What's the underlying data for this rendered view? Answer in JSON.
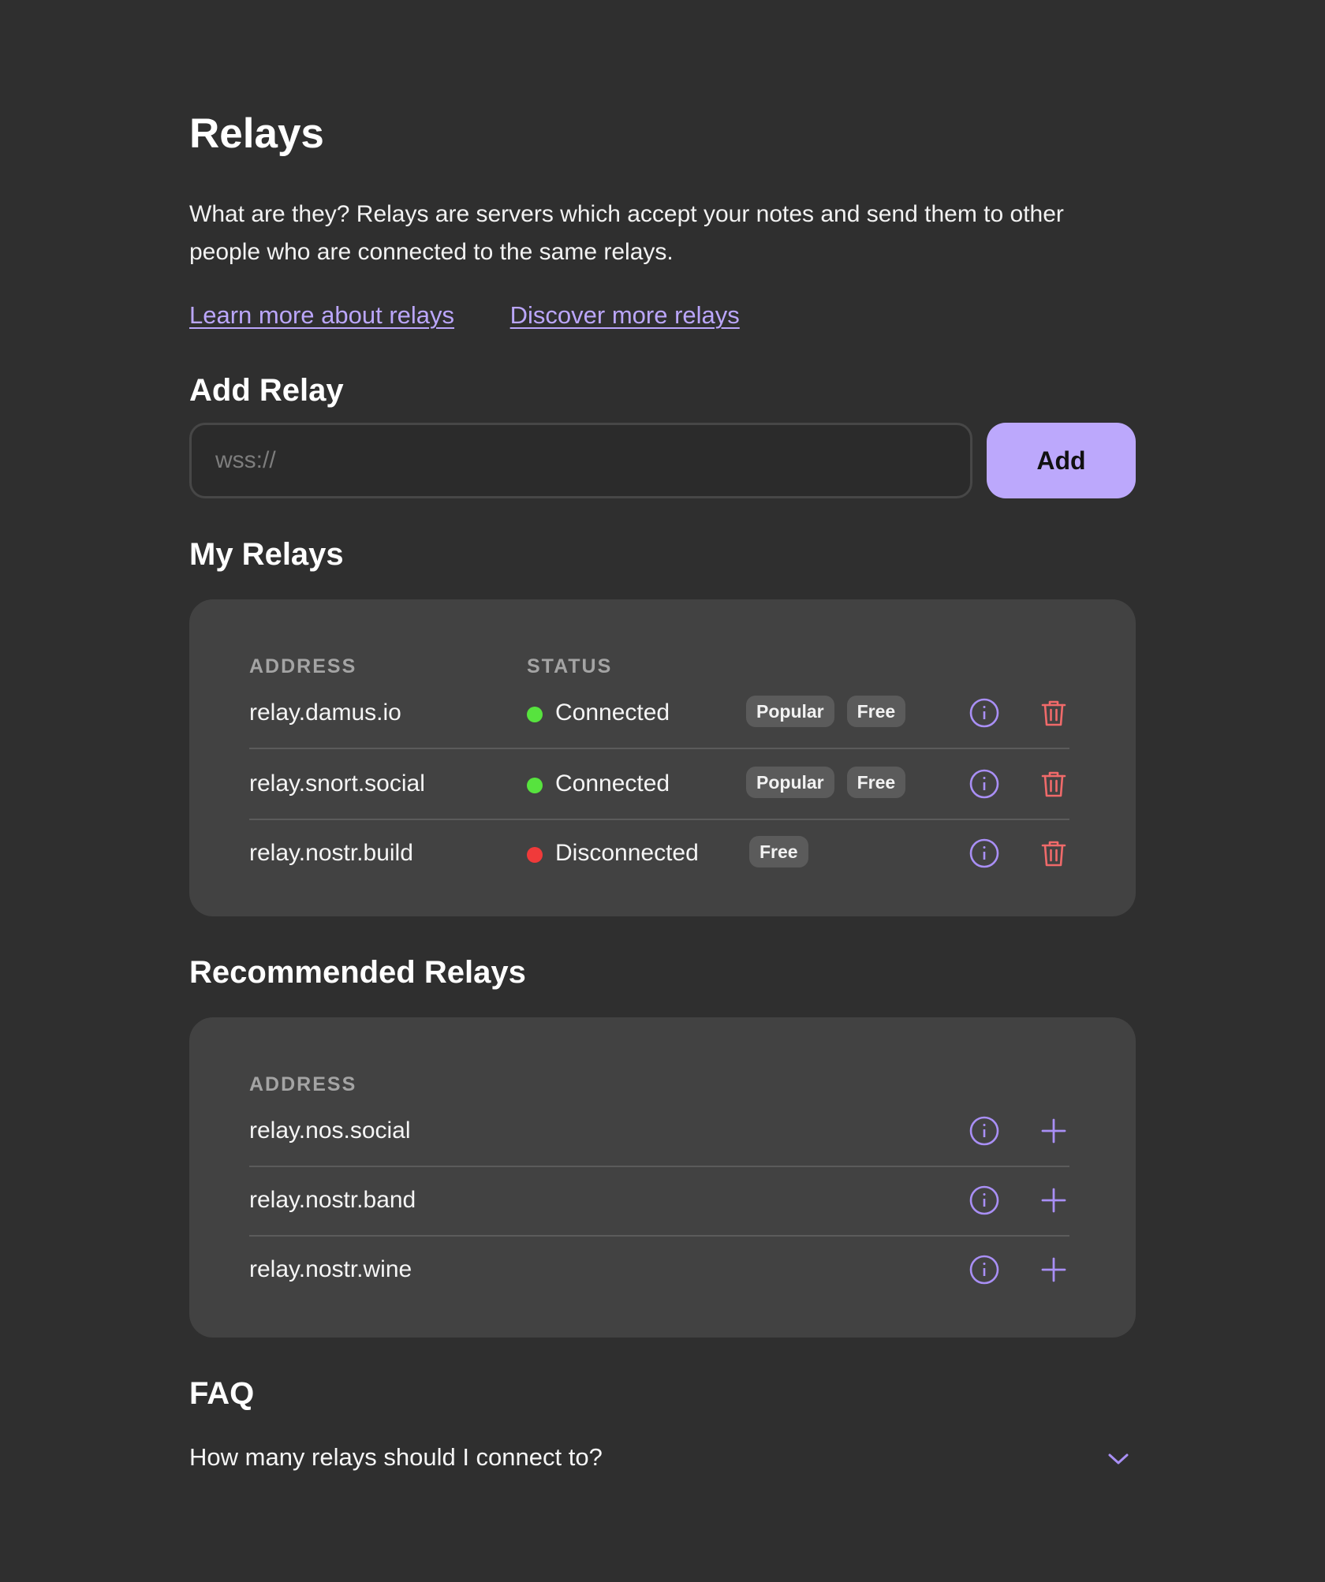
{
  "page": {
    "title": "Relays",
    "intro": "What are they? Relays are servers which accept your notes and send them to other people who are connected to the same relays.",
    "links": [
      {
        "label": "Learn more about relays"
      },
      {
        "label": "Discover more relays"
      }
    ]
  },
  "add_relay": {
    "heading": "Add Relay",
    "input_value": "",
    "placeholder": "wss://",
    "button_label": "Add"
  },
  "my_relays": {
    "heading": "My Relays",
    "columns": [
      "ADDRESS",
      "STATUS"
    ],
    "rows": [
      {
        "address": "relay.damus.io",
        "status": "Connected",
        "status_color": "#57e33e",
        "tags": [
          "Popular",
          "Free"
        ]
      },
      {
        "address": "relay.snort.social",
        "status": "Connected",
        "status_color": "#57e33e",
        "tags": [
          "Popular",
          "Free"
        ]
      },
      {
        "address": "relay.nostr.build",
        "status": "Disconnected",
        "status_color": "#f03a3a",
        "tags": [
          "Free"
        ]
      }
    ],
    "row_icons": [
      "info-icon",
      "trash-icon"
    ]
  },
  "recommended_relays": {
    "heading": "Recommended Relays",
    "columns": [
      "ADDRESS"
    ],
    "rows": [
      {
        "address": "relay.nos.social"
      },
      {
        "address": "relay.nostr.band"
      },
      {
        "address": "relay.nostr.wine"
      }
    ],
    "row_icons": [
      "info-icon",
      "plus-icon"
    ]
  },
  "faq": {
    "heading": "FAQ",
    "items": [
      {
        "question": "How many relays should I connect to?",
        "icon": "chevron-down-icon"
      }
    ]
  },
  "colors": {
    "background": "#2f2f2f",
    "card": "#424242",
    "accent": "#bca8fc",
    "link": "#bba6fb",
    "danger": "#f06a6a",
    "connected": "#57e33e",
    "disconnected": "#f03a3a"
  }
}
